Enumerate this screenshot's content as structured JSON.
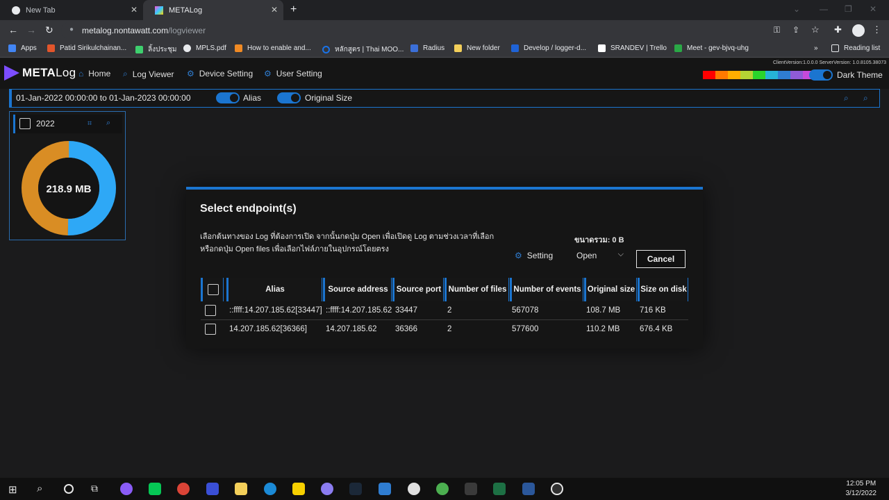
{
  "browser": {
    "tabs": [
      {
        "title": "New Tab",
        "active": false
      },
      {
        "title": "METALog",
        "active": true
      }
    ],
    "url": {
      "host": "metalog.nontawatt.com",
      "path": "/logviewer"
    },
    "bookmarks": [
      {
        "label": "Apps",
        "color": "#4285f4"
      },
      {
        "label": "Patid Sirikulchainan...",
        "color": "#e2552b"
      },
      {
        "label": "ลิ้งประชุม",
        "color": "#3ecf6e"
      },
      {
        "label": "MPLS.pdf",
        "color": "#e8eaed"
      },
      {
        "label": "How to enable and...",
        "color": "#f08a24"
      },
      {
        "label": "หลักสูตร | Thai MOO...",
        "color": "#1a73e8"
      },
      {
        "label": "Radius",
        "color": "#3b6fd8"
      },
      {
        "label": "New folder",
        "color": "#f3cf5a"
      },
      {
        "label": "Develop / logger-d...",
        "color": "#1f63d6"
      },
      {
        "label": "SRANDEV | Trello",
        "color": "#ffffff"
      },
      {
        "label": "Meet - gev-bjvq-uhg",
        "color": "#2aa846"
      }
    ],
    "bookmarks_more": "»",
    "reading_list": "Reading list"
  },
  "app": {
    "logo_bold": "META",
    "logo_rest": "Log",
    "nav": [
      {
        "label": "Home",
        "icon": "home-icon"
      },
      {
        "label": "Log Viewer",
        "icon": "search-doc-icon"
      },
      {
        "label": "Device Setting",
        "icon": "gear-icon"
      },
      {
        "label": "User Setting",
        "icon": "gear-icon"
      }
    ],
    "version": "ClientVersion:1.0.0.0 ServerVersion: 1.0.8105.38073",
    "theme_colors": [
      "#ff0000",
      "#ff7a00",
      "#ffae00",
      "#b5d334",
      "#2bd42b",
      "#26b3d6",
      "#2f7dd1",
      "#8f5bd6",
      "#c64ad9",
      "#ff22dd"
    ],
    "dark_theme_label": "Dark Theme"
  },
  "filter": {
    "range": "01-Jan-2022 00:00:00 to 01-Jan-2023 00:00:00",
    "alias_label": "Alias",
    "original_size_label": "Original Size"
  },
  "year_card": {
    "year": "2022",
    "total": "218.9 MB",
    "donut": {
      "colors": [
        "#2ea8f6",
        "#d98d24"
      ],
      "fractions": [
        0.503,
        0.497
      ]
    }
  },
  "modal": {
    "title": "Select endpoint(s)",
    "desc_line1": "เลือกต้นทางของ Log ที่ต้องการเปิด จากนั้นกดปุ่ม Open เพื่อเปิดดู Log ตามช่วงเวลาที่เลือก",
    "desc_line2": "หรือกดปุ่ม Open files เพื่อเลือกไฟล์ภายในอุปกรณ์โดยตรง",
    "total_size": "ขนาดรวม: 0 B",
    "setting_label": "Setting",
    "open_label": "Open",
    "cancel_label": "Cancel",
    "columns": [
      "Alias",
      "Source address",
      "Source port",
      "Number of files",
      "Number of events",
      "Original size",
      "Size on disk"
    ],
    "rows": [
      [
        "::ffff:14.207.185.62[33447]",
        "::ffff:14.207.185.62",
        "33447",
        "2",
        "567078",
        "108.7 MB",
        "716 KB"
      ],
      [
        "14.207.185.62[36366]",
        "14.207.185.62",
        "36366",
        "2",
        "577600",
        "110.2 MB",
        "676.4 KB"
      ]
    ]
  },
  "taskbar": {
    "time": "12:05 PM",
    "date": "3/12/2022"
  }
}
